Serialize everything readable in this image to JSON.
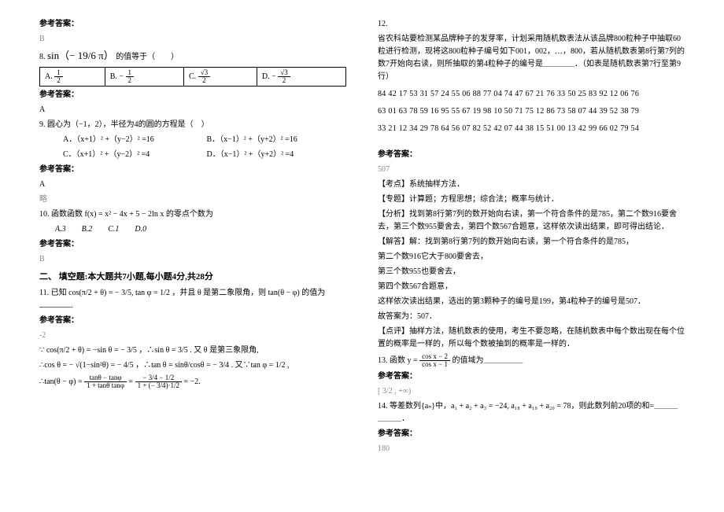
{
  "left": {
    "ans_label": "参考答案：",
    "B": "B",
    "A": "A",
    "lue": "略",
    "q8": {
      "num": "8.",
      "expr": "sin（− 19/6 π）",
      "tail": "的值等于（　　）",
      "choices": {
        "A": "A.",
        "Av": "1/2",
        "B": "B.",
        "Bv": "− 1/2",
        "C": "C.",
        "Cv": "√3 / 2",
        "D": "D.",
        "Dv": "− √3 / 2"
      }
    },
    "q9": {
      "text": "9. 圆心为（−1，2），半径为4的圆的方程是（　）",
      "a": "A．（x+1）² +（y−2）² =16",
      "b": "B．（x−1）² +（y+2）² =16",
      "c": "C．（x+1）² +（y−2）² =4",
      "d": "D．（x−1）² +（y+2）² =4"
    },
    "q10": {
      "text": "10. 函数函数 f(x) = x² − 4x + 5 − 2ln x 的零点个数为",
      "choices": "A.3　　B.2　　C.1　　D.0"
    },
    "section2": "二、 填空题:本大题共7小题,每小题4分,共28分",
    "q11": {
      "pre": "11. 已知",
      "e1": "cos(π/2 + θ) = − 3/5, tan φ = 1/2",
      "mid": "，并且 θ 是第二象限角，则 tan(θ − φ) 的值为",
      "ans": "-2",
      "s1": "∵ cos(π/2 + θ) = −sin θ = − 3/5 ，∴sin θ = 3/5 . 又 θ 是第三象限角,",
      "s2": "∴cos θ = − √(1−sin²θ) = − 4/5 ，∴tan θ = sinθ/cosθ = − 3/4 . 又∵tan φ = 1/2 ,",
      "s3_pre": "∴tan(θ − φ) =",
      "s3_num": "tanθ − tanφ",
      "s3_den": "1 + tanθ tanφ",
      "s3_eq": "=",
      "s4_num": "− 3/4 − 1/2",
      "s4_den": "1 + (− 3/4)·1/2",
      "s3_res": "= −2."
    }
  },
  "right": {
    "q12": {
      "num": "12.",
      "l1": "省农科站要检测某品牌种子的发芽率，计划采用随机数表法从该品牌800粒种子中抽取60粒进行检测，现将这800粒种子编号如下001，002，…，800，若从随机数表第8行第7列的数7开始向右读，则所抽取的第4粒种子的编号是＿＿＿＿．（如表是随机数表第7行至第9行）",
      "row1": "84 42 17 53 31  57 24 55 06 88  77 04 74 47 67  21 76 33 50 25  83 92 12 06 76",
      "row2": "63 01 63 78 59  16 95 55 67 19  98 10 50 71 75  12 86 73 58 07  44 39 52 38 79",
      "row3": "33 21 12 34 29  78 64 56 07 82  52 42 07 44 38  15 51 00 13 42  99 66 02 79 54",
      "ans_label": "参考答案：",
      "ans": "507",
      "kd": "【考点】系统抽样方法．",
      "zt": "【专题】计算题；方程思想；综合法；概率与统计．",
      "fx": "【分析】找到第8行第7列的数开始向右读，第一个符合条件的是785，第二个数916要舍去，第三个数955要舍去，第四个数567合题意，这样依次读出结果，即可得出结论．",
      "jd1": "【解答】解：找到第8行第7列的数开始向右读，第一个符合条件的是785，",
      "jd2": "第二个数916它大于800要舍去，",
      "jd3": "第三个数955也要舍去，",
      "jd4": "第四个数567合题意，",
      "jd5": "这样依次读出结果，选出的第3颗种子的编号是199，第4粒种子的编号是507．",
      "jd6": "故答案为：507．",
      "dp": "【点评】抽样方法，随机数表的使用，考生不要忽略，在随机数表中每个数出现在每个位置的概率是一样的，所以每个数被抽到的概率是一样的．"
    },
    "q13": {
      "pre": "13. 函数",
      "expr_num": "cos x − 2",
      "expr_den": "cos x − 1",
      "mid": "y =",
      "tail": "的值域为＿＿＿＿＿",
      "ans_label": "参考答案：",
      "ans": "[ 3/2 , +∞)"
    },
    "q14": {
      "text": "14.  等差数列{aₙ}中，a₁ + a₂ + a₃ = −24, a₁₈ + a₁₉ + a₂₀ = 78，则此数列前20项的和=＿＿＿＿＿＿．",
      "ans_label": "参考答案：",
      "ans": "180"
    }
  }
}
